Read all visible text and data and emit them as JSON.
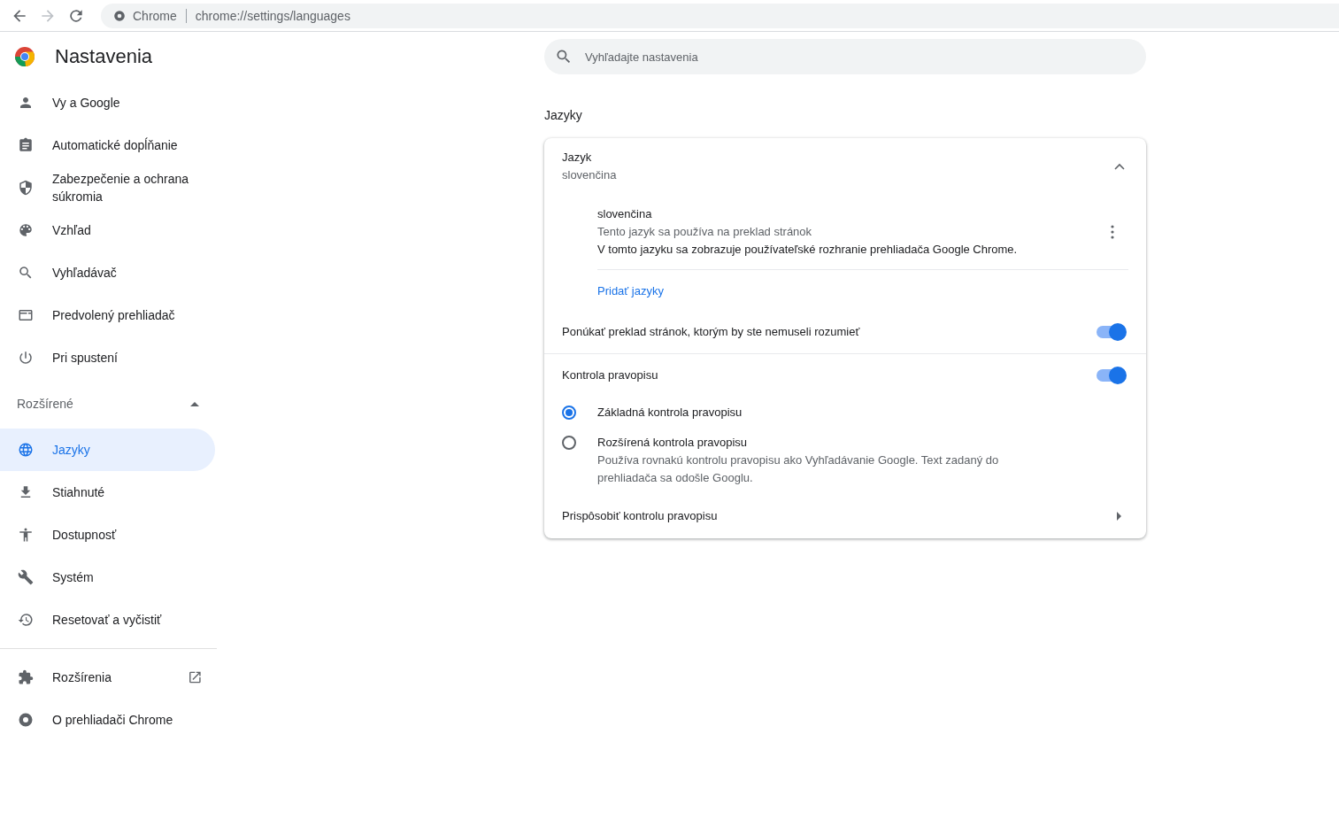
{
  "browser": {
    "site_label": "Chrome",
    "url": "chrome://settings/languages"
  },
  "header": {
    "title": "Nastavenia"
  },
  "search": {
    "placeholder": "Vyhľadajte nastavenia"
  },
  "sidebar": {
    "items": [
      {
        "label": "Vy a Google",
        "selected": false
      },
      {
        "label": "Automatické dopĺňanie",
        "selected": false
      },
      {
        "label": "Zabezpečenie a ochrana súkromia",
        "selected": false
      },
      {
        "label": "Vzhľad",
        "selected": false
      },
      {
        "label": "Vyhľadávač",
        "selected": false
      },
      {
        "label": "Predvolený prehliadač",
        "selected": false
      },
      {
        "label": "Pri spustení",
        "selected": false
      }
    ],
    "advanced": {
      "label": "Rozšírené",
      "expanded": true,
      "items": [
        {
          "label": "Jazyky",
          "selected": true
        },
        {
          "label": "Stiahnuté",
          "selected": false
        },
        {
          "label": "Dostupnosť",
          "selected": false
        },
        {
          "label": "Systém",
          "selected": false
        },
        {
          "label": "Resetovať a vyčistiť",
          "selected": false
        }
      ]
    },
    "bottom_items": [
      {
        "label": "Rozšírenia",
        "external": true
      },
      {
        "label": "O prehliadači Chrome",
        "external": false
      }
    ]
  },
  "section_title": "Jazyky",
  "language": {
    "title": "Jazyk",
    "value": "slovenčina",
    "expanded": true,
    "entries": [
      {
        "name": "slovenčina",
        "lines": [
          {
            "text": "Tento jazyk sa používa na preklad stránok",
            "kind": "muted"
          },
          {
            "text": "V tomto jazyku sa zobrazuje používateľské rozhranie prehliadača Google Chrome.",
            "kind": "normal"
          }
        ]
      }
    ],
    "add_link": "Pridať jazyky"
  },
  "translate_toggle": {
    "label": "Ponúkať preklad stránok, ktorým by ste nemuseli rozumieť",
    "on": true
  },
  "spellcheck": {
    "label": "Kontrola pravopisu",
    "on": true,
    "options": [
      {
        "label": "Základná kontrola pravopisu",
        "selected": true
      },
      {
        "label": "Rozšírená kontrola pravopisu",
        "description": "Používa rovnakú kontrolu pravopisu ako Vyhľadávanie Google. Text zadaný do prehliadača sa odošle Googlu.",
        "selected": false
      }
    ],
    "customize": "Prispôsobiť kontrolu pravopisu"
  }
}
